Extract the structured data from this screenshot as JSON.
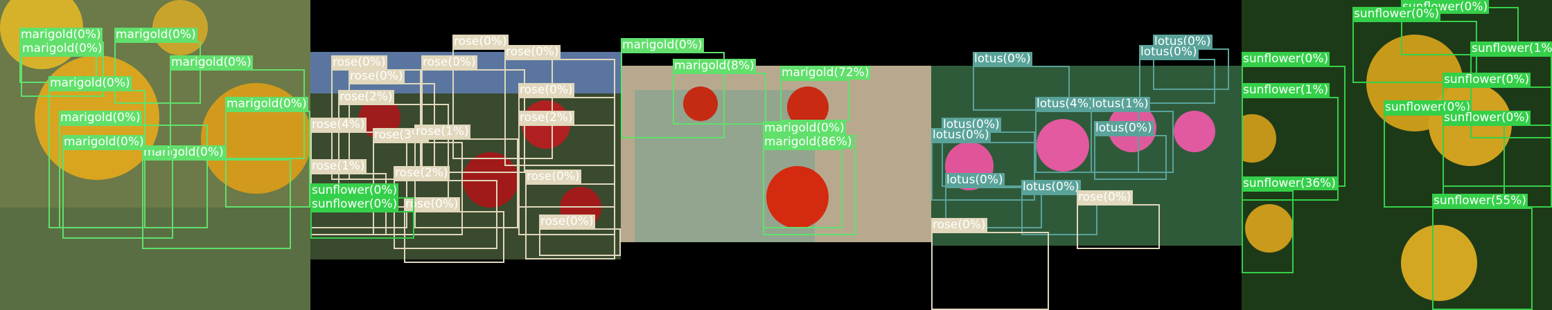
{
  "panels": [
    {
      "class": "marigold",
      "box_color": "#61e06c",
      "label_bg": "#61e06c",
      "label_fg": "#ffffff",
      "detections": [
        {
          "label": "marigold(0%)",
          "box": [
            28,
            60,
            140,
            120
          ]
        },
        {
          "label": "marigold(0%)",
          "box": [
            165,
            60,
            290,
            150
          ]
        },
        {
          "label": "marigold(0%)",
          "box": [
            30,
            80,
            150,
            140
          ]
        },
        {
          "label": "marigold(0%)",
          "box": [
            245,
            100,
            440,
            230
          ]
        },
        {
          "label": "marigold(0%)",
          "box": [
            70,
            130,
            210,
            330
          ]
        },
        {
          "label": "marigold(0%)",
          "box": [
            325,
            160,
            448,
            300
          ]
        },
        {
          "label": "marigold(0%)",
          "box": [
            85,
            180,
            300,
            330
          ]
        },
        {
          "label": "marigold(0%)",
          "box": [
            205,
            230,
            420,
            360
          ]
        },
        {
          "label": "marigold(0%)",
          "box": [
            90,
            215,
            250,
            345
          ]
        }
      ]
    },
    {
      "class": "rose",
      "box_color": "#e1d8bd",
      "label_bg": "#e1d8bd",
      "label_fg": "#ffffff",
      "detections": [
        {
          "label": "rose(0%)",
          "box": [
            30,
            100,
            160,
            260
          ]
        },
        {
          "label": "rose(0%)",
          "box": [
            55,
            120,
            180,
            260
          ]
        },
        {
          "label": "rose(2%)",
          "box": [
            40,
            150,
            200,
            300
          ]
        },
        {
          "label": "rose(4%)",
          "box": [
            0,
            190,
            140,
            330
          ]
        },
        {
          "label": "rose(3%)",
          "box": [
            90,
            205,
            220,
            340
          ]
        },
        {
          "label": "rose(1%)",
          "box": [
            0,
            250,
            110,
            340
          ]
        },
        {
          "label": "rose(0%)",
          "box": [
            160,
            100,
            310,
            250
          ]
        },
        {
          "label": "rose(0%)",
          "box": [
            205,
            70,
            350,
            230
          ]
        },
        {
          "label": "rose(0%)",
          "box": [
            280,
            85,
            440,
            240
          ]
        },
        {
          "label": "rose(0%)",
          "box": [
            300,
            140,
            440,
            300
          ]
        },
        {
          "label": "rose(2%)",
          "box": [
            300,
            180,
            440,
            340
          ]
        },
        {
          "label": "rose(1%)",
          "box": [
            150,
            200,
            300,
            330
          ]
        },
        {
          "label": "rose(2%)",
          "box": [
            120,
            260,
            270,
            360
          ]
        },
        {
          "label": "rose(0%)",
          "box": [
            310,
            265,
            440,
            375
          ]
        },
        {
          "label": "rose(0%)",
          "box": [
            135,
            305,
            280,
            380
          ]
        },
        {
          "label": "rose(0%)",
          "box": [
            330,
            330,
            448,
            370
          ]
        }
      ],
      "extra": [
        {
          "label": "sunflower(0%)",
          "box": [
            0,
            285,
            150,
            345
          ],
          "bg": "#35d04a"
        },
        {
          "label": "sunflower(0%)",
          "box": [
            0,
            305,
            150,
            345
          ],
          "bg": "#35d04a"
        }
      ]
    },
    {
      "class": "marigold",
      "box_color": "#61e06c",
      "label_bg": "#61e06c",
      "label_fg": "#ffffff",
      "detections": [
        {
          "label": "marigold(0%)",
          "box": [
            0,
            75,
            150,
            200
          ]
        },
        {
          "label": "marigold(8%)",
          "box": [
            75,
            105,
            210,
            180
          ]
        },
        {
          "label": "marigold(72%)",
          "box": [
            230,
            115,
            330,
            175
          ]
        },
        {
          "label": "marigold(0%)",
          "box": [
            205,
            195,
            340,
            340
          ]
        },
        {
          "label": "marigold(86%)",
          "box": [
            205,
            215,
            320,
            330
          ]
        }
      ]
    },
    {
      "class": "lotus",
      "box_color": "#5aa39a",
      "label_bg": "#5aa39a",
      "label_fg": "#ffffff",
      "detections": [
        {
          "label": "lotus(0%)",
          "box": [
            60,
            95,
            200,
            160
          ]
        },
        {
          "label": "lotus(0%)",
          "box": [
            320,
            70,
            430,
            130
          ]
        },
        {
          "label": "lotus(0%)",
          "box": [
            300,
            85,
            410,
            150
          ]
        },
        {
          "label": "lotus(4%)",
          "box": [
            150,
            160,
            300,
            250
          ]
        },
        {
          "label": "lotus(1%)",
          "box": [
            230,
            160,
            350,
            250
          ]
        },
        {
          "label": "lotus(0%)",
          "box": [
            235,
            195,
            340,
            260
          ]
        },
        {
          "label": "lotus(0%)",
          "box": [
            15,
            190,
            150,
            270
          ]
        },
        {
          "label": "lotus(0%)",
          "box": [
            0,
            205,
            150,
            290
          ]
        },
        {
          "label": "lotus(0%)",
          "box": [
            20,
            270,
            160,
            330
          ]
        },
        {
          "label": "lotus(0%)",
          "box": [
            130,
            280,
            240,
            340
          ]
        }
      ],
      "extra": [
        {
          "label": "rose(0%)",
          "box": [
            210,
            295,
            330,
            360
          ],
          "bg": "#e1d8bd"
        },
        {
          "label": "rose(0%)",
          "box": [
            0,
            335,
            170,
            448
          ],
          "bg": "#e1d8bd"
        }
      ]
    },
    {
      "class": "sunflower",
      "box_color": "#35d04a",
      "label_bg": "#35d04a",
      "label_fg": "#ffffff",
      "detections": [
        {
          "label": "sunflower(0%)",
          "box": [
            230,
            10,
            400,
            80
          ]
        },
        {
          "label": "sunflower(0%)",
          "box": [
            160,
            30,
            340,
            120
          ]
        },
        {
          "label": "sunflower(0%)",
          "box": [
            0,
            95,
            150,
            270
          ]
        },
        {
          "label": "sunflower(1%)",
          "box": [
            330,
            80,
            448,
            200
          ]
        },
        {
          "label": "sunflower(0%)",
          "box": [
            290,
            125,
            448,
            270
          ]
        },
        {
          "label": "sunflower(1%)",
          "box": [
            0,
            140,
            140,
            290
          ]
        },
        {
          "label": "sunflower(0%)",
          "box": [
            205,
            165,
            380,
            300
          ]
        },
        {
          "label": "sunflower(0%)",
          "box": [
            290,
            180,
            448,
            300
          ]
        },
        {
          "label": "sunflower(36%)",
          "box": [
            0,
            275,
            75,
            395
          ]
        },
        {
          "label": "sunflower(55%)",
          "box": [
            275,
            300,
            420,
            448
          ]
        }
      ]
    }
  ]
}
